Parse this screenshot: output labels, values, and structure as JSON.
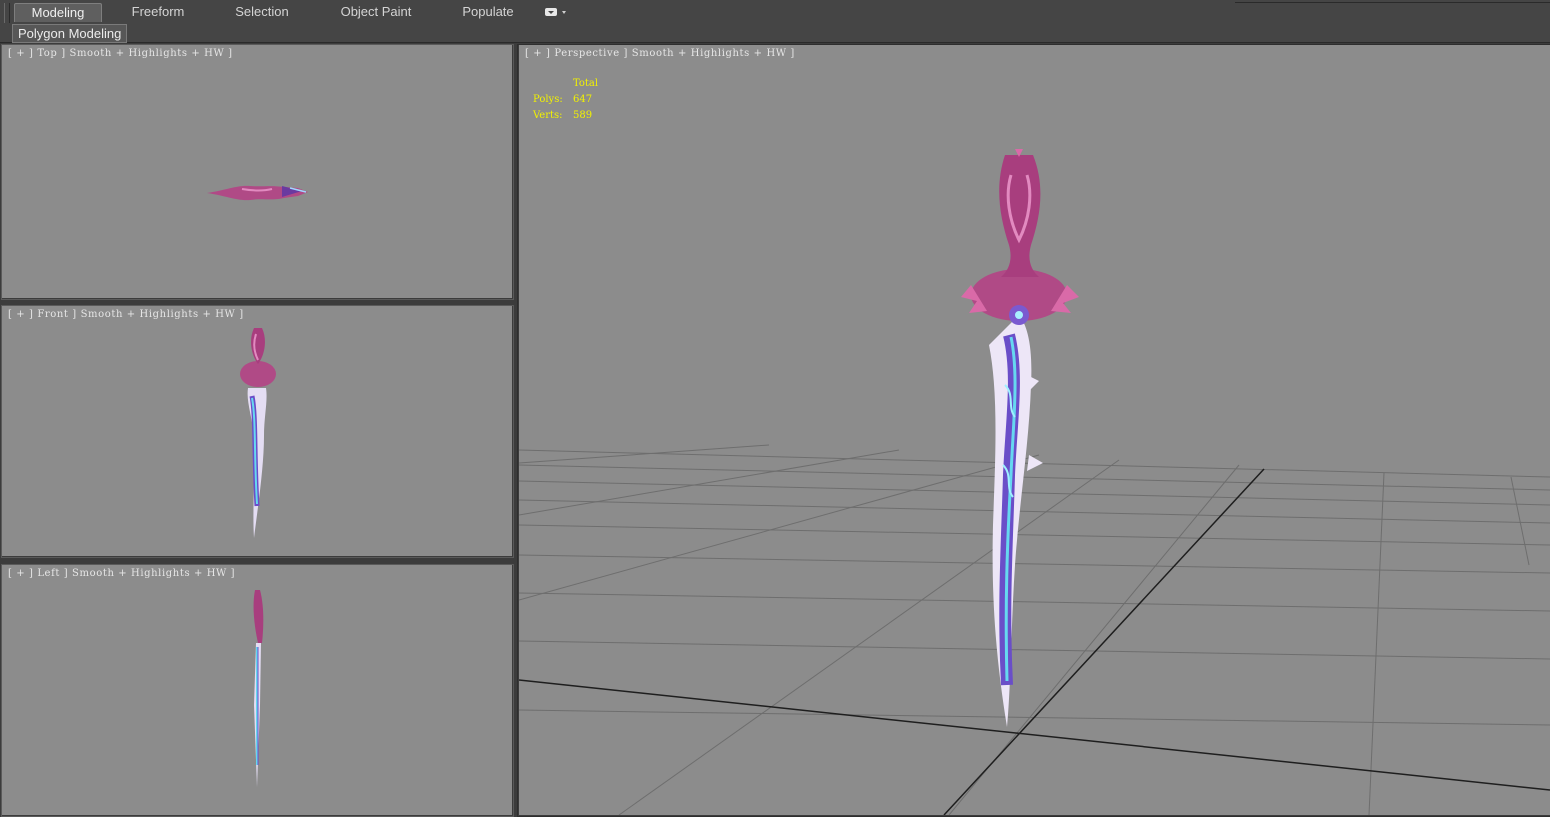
{
  "ribbon": {
    "tabs": [
      {
        "label": "Modeling",
        "active": true
      },
      {
        "label": "Freeform",
        "active": false
      },
      {
        "label": "Selection",
        "active": false
      },
      {
        "label": "Object Paint",
        "active": false
      },
      {
        "label": "Populate",
        "active": false
      }
    ],
    "dropdown_icon": "ribbon-options-icon"
  },
  "panel": {
    "label": "Polygon Modeling"
  },
  "viewports": {
    "top": {
      "label": "[ + ] Top ] Smooth + Highlights + HW ]"
    },
    "front": {
      "label": "[ + ] Front ] Smooth + Highlights + HW ]"
    },
    "left": {
      "label": "[ + ] Left ] Smooth + Highlights + HW ]"
    },
    "perspective": {
      "label": "[ + ] Perspective ] Smooth + Highlights + HW ]",
      "stats": {
        "header": "Total",
        "polys_label": "Polys:",
        "polys": "647",
        "verts_label": "Verts:",
        "verts": "589"
      }
    }
  },
  "colors": {
    "viewport_bg": "#8c8c8c",
    "stats_text": "#f2f200",
    "grid_line": "#6e6e6e",
    "hilt_magenta": "#b04a86",
    "blade_glow": "#66d8f0",
    "blade_purple": "#6a4ec8"
  }
}
